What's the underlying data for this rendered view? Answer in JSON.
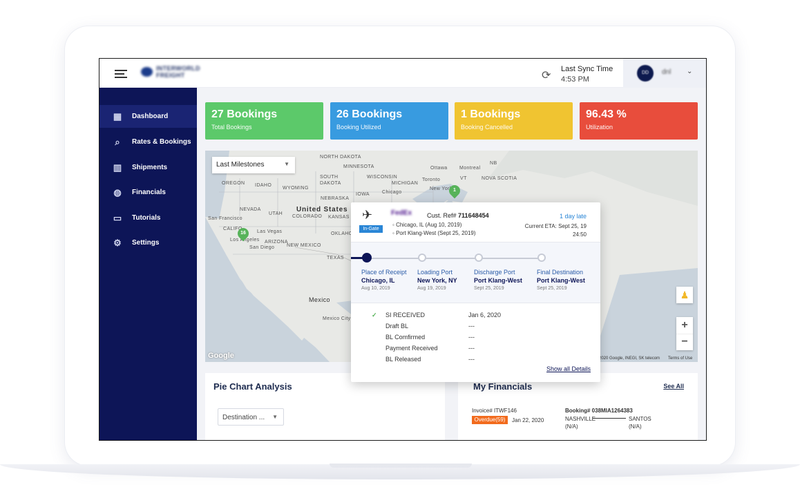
{
  "header": {
    "brand": "INTERWORLD FREIGHT",
    "sync_label": "Last Sync Time",
    "sync_time": "4:53 PM",
    "avatar_initials": "DD",
    "user_name": "dnl"
  },
  "sidebar": {
    "items": [
      {
        "label": "Dashboard",
        "icon": "dashboard-icon",
        "active": true
      },
      {
        "label": "Rates & Bookings",
        "icon": "search-icon"
      },
      {
        "label": "Shipments",
        "icon": "shipments-icon"
      },
      {
        "label": "Financials",
        "icon": "financials-icon"
      },
      {
        "label": "Tutorials",
        "icon": "book-icon"
      },
      {
        "label": "Settings",
        "icon": "gear-icon"
      }
    ]
  },
  "stats": [
    {
      "value": "27 Bookings",
      "label": "Total Bookings",
      "color": "#5cc96a"
    },
    {
      "value": "26 Bookings",
      "label": "Booking Utilized",
      "color": "#389be0"
    },
    {
      "value": "1 Bookings",
      "label": "Booking Cancelled",
      "color": "#f0c431"
    },
    {
      "value": "96.43 %",
      "label": "Utilization",
      "color": "#e84d3c"
    }
  ],
  "map": {
    "filter": "Last Milestones",
    "labels": {
      "north_dakota": "NORTH DAKOTA",
      "minnesota": "MINNESOTA",
      "ottawa": "Ottawa",
      "montreal": "Montreal",
      "nb": "NB",
      "oregon": "OREGON",
      "idaho": "IDAHO",
      "wyoming": "WYOMING",
      "south_dakota": "SOUTH DAKOTA",
      "wisconsin": "WISCONSIN",
      "michigan": "MICHIGAN",
      "toronto": "Toronto",
      "vt": "VT",
      "nova_scotia": "NOVA SCOTIA",
      "nebraska": "NEBRASKA",
      "iowa": "IOWA",
      "chicago": "Chicago",
      "new_york": "New York",
      "nevada": "NEVADA",
      "united_states": "United States",
      "utah": "UTAH",
      "colorado": "COLORADO",
      "kansas": "KANSAS",
      "san_francisco": "San Francisco",
      "california": "CALIFO",
      "las_vegas": "Las Vegas",
      "oklahoma": "OKLAHO",
      "los_angeles": "Los Angeles",
      "san_diego": "San Diego",
      "arizona": "ARIZONA",
      "new_mexico": "NEW MEXICO",
      "texas": "TEXAS",
      "mexico": "Mexico",
      "mexico_city": "Mexico City"
    },
    "pins": [
      "16",
      "1"
    ],
    "attribution": "2020 Google, INEGI, SK telecom",
    "terms": "Terms of Use",
    "google": "Google"
  },
  "popup": {
    "status": "In-Gate",
    "carrier": "FedEx",
    "cust_ref_label": "Cust. Ref#",
    "cust_ref": "711648454",
    "origin": "Chicago, IL (Aug 10, 2019)",
    "destination": "Port Klang-West (Sept 25, 2019)",
    "late": "1 day late",
    "eta": "Current ETA: Sept 25, 19",
    "eta_time": "24:50",
    "steps": [
      {
        "title": "Place of Receipt",
        "place": "Chicago, IL",
        "date": "Aug 10, 2019"
      },
      {
        "title": "Loading Port",
        "place": "New York, NY",
        "date": "Aug 19, 2019"
      },
      {
        "title": "Discharge Port",
        "place": "Port Klang-West",
        "date": "Sept 25, 2019"
      },
      {
        "title": "Final Destination",
        "place": "Port Klang-West",
        "date": "Sept 25, 2019"
      }
    ],
    "milestones": [
      {
        "name": "SI RECEIVED",
        "date": "Jan 6, 2020",
        "done": true
      },
      {
        "name": "Draft BL",
        "date": "---"
      },
      {
        "name": "BL Comfirmed",
        "date": "---"
      },
      {
        "name": "Payment Received",
        "date": "---"
      },
      {
        "name": "BL Released",
        "date": "---"
      }
    ],
    "show_all": "Show all Details"
  },
  "pie": {
    "title": "Pie Chart Analysis",
    "select": "Destination ..."
  },
  "financials": {
    "title": "My Financials",
    "see_all": "See All",
    "invoice": "Invoice# ITWF146",
    "overdue": "Overdue(59)",
    "invoice_date": "Jan 22, 2020",
    "booking": "Booking# 038MIA1264383",
    "from": "NASHVILLE",
    "from_sub": "(N/A)",
    "to": "SANTOS",
    "to_sub": "(N/A)"
  }
}
